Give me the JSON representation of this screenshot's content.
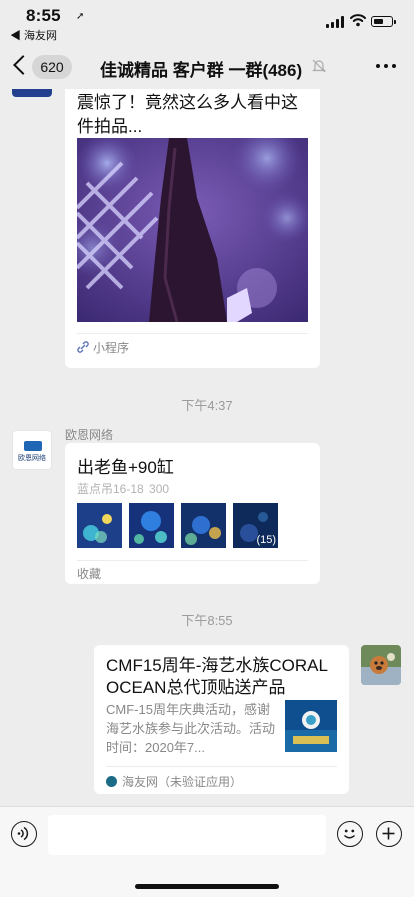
{
  "status_bar": {
    "time": "8:55",
    "back_app": "◀ 海友网"
  },
  "nav": {
    "back_count": "620",
    "title": "佳诚精品 客户群 一群(486)"
  },
  "messages": {
    "miniprogram": {
      "title": "震惊了！竟然这么多人看中这件拍品...",
      "footer_label": "小程序"
    },
    "timestamp_1": "下午4:37",
    "favorites": {
      "sender": "欧恩网络",
      "avatar_text": "欧恩网络",
      "title": "出老鱼+90缸",
      "subtitle": "蓝点吊16-18    300",
      "more_count": "(15)",
      "footer_label": "收藏"
    },
    "timestamp_2": "下午8:55",
    "article": {
      "title": "CMF15周年-海艺水族CORAL OCEAN总代顶贴送产品",
      "description": "CMF-15周年庆典活动，感谢海艺水族参与此次活动。活动时间：2020年7...",
      "source": "海友网（未验证应用）"
    }
  },
  "input_bar": {
    "placeholder": ""
  },
  "colors": {
    "background": "#ededed",
    "bubble": "#ffffff",
    "meta_text": "#888888",
    "timestamp": "#9b9b9b"
  },
  "icons": [
    "location-arrow-icon",
    "signal-icon",
    "wifi-icon",
    "battery-icon",
    "chevron-left-icon",
    "mute-icon",
    "more-icon",
    "link-icon",
    "voice-icon",
    "emoji-icon",
    "plus-icon"
  ]
}
